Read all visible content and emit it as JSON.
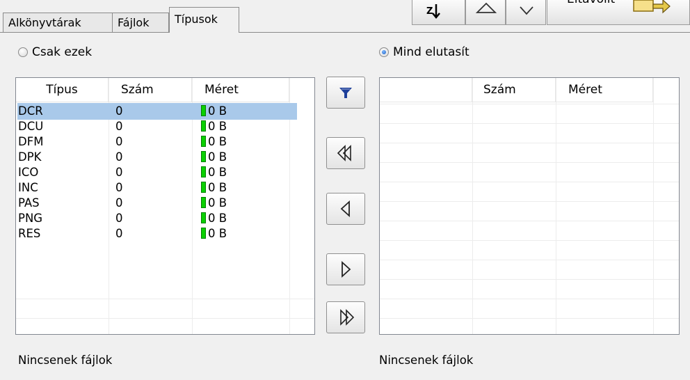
{
  "tabs": [
    {
      "label": "Alkönyvtárak"
    },
    {
      "label": "Fájlok"
    },
    {
      "label": "Típusok",
      "active": true
    }
  ],
  "toolbar": {
    "remove_label": "Eltávolít",
    "icons": [
      "sort-icon",
      "up-icon",
      "down-icon",
      "remove-icon"
    ]
  },
  "left_panel": {
    "radio_label": "Csak ezek",
    "radio_checked": false,
    "columns": [
      "Típus",
      "Szám",
      "Méret"
    ],
    "rows": [
      {
        "type": "DCR",
        "count": "0",
        "size": "0 B",
        "selected": true
      },
      {
        "type": "DCU",
        "count": "0",
        "size": "0 B"
      },
      {
        "type": "DFM",
        "count": "0",
        "size": "0 B"
      },
      {
        "type": "DPK",
        "count": "0",
        "size": "0 B"
      },
      {
        "type": "ICO",
        "count": "0",
        "size": "0 B"
      },
      {
        "type": "INC",
        "count": "0",
        "size": "0 B"
      },
      {
        "type": "PAS",
        "count": "0",
        "size": "0 B"
      },
      {
        "type": "PNG",
        "count": "0",
        "size": "0 B"
      },
      {
        "type": "RES",
        "count": "0",
        "size": "0 B"
      }
    ],
    "status": "Nincsenek fájlok"
  },
  "right_panel": {
    "radio_label": "Mind elutasít",
    "radio_checked": true,
    "columns": [
      "",
      "Szám",
      "Méret"
    ],
    "status": "Nincsenek fájlok"
  },
  "side_buttons": [
    "filter-icon",
    "move-all-left-icon",
    "move-left-icon",
    "move-right-icon",
    "move-all-right-icon"
  ],
  "colors": {
    "selection": "#a9c9ea",
    "size_bar": "#0ad000",
    "background": "#f0f0f0"
  }
}
